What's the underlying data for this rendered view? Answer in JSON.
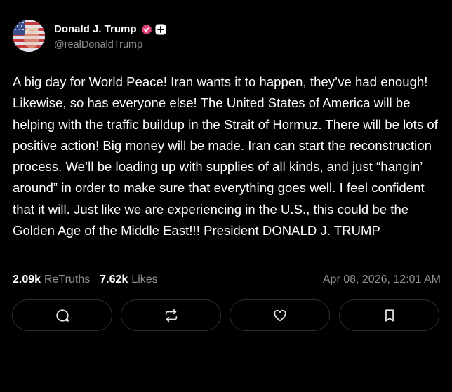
{
  "author": {
    "display_name": "Donald J. Trump",
    "handle": "@realDonaldTrump",
    "verified_icon": "verified-badge-icon",
    "follow_icon": "plus-badge-icon"
  },
  "post": {
    "text": "A big day for World Peace! Iran wants it to happen, they’ve had enough! Likewise, so has everyone else! The United States of America will be helping with the traffic buildup in the Strait of Hormuz. There will be lots of positive action! Big money will be made. Iran can start the reconstruction process. We’ll be loading up with supplies of all kinds, and just “hangin’ around” in order to make sure that everything goes well. I feel confident that it will. Just like we are experiencing in the U.S., this could be the Golden Age of the Middle East!!! President DONALD J. TRUMP"
  },
  "stats": {
    "retruths_count": "2.09k",
    "retruths_label": "ReTruths",
    "likes_count": "7.62k",
    "likes_label": "Likes",
    "timestamp": "Apr 08, 2026, 12:01 AM"
  },
  "actions": [
    {
      "name": "reply",
      "icon": "comment-icon"
    },
    {
      "name": "retruth",
      "icon": "repost-icon"
    },
    {
      "name": "like",
      "icon": "heart-icon"
    },
    {
      "name": "bookmark",
      "icon": "bookmark-icon"
    }
  ],
  "colors": {
    "background": "#000000",
    "text_primary": "#ffffff",
    "text_secondary": "#8e8e93",
    "verified_accent": "#e0457b",
    "button_border": "#2c2c2e"
  }
}
